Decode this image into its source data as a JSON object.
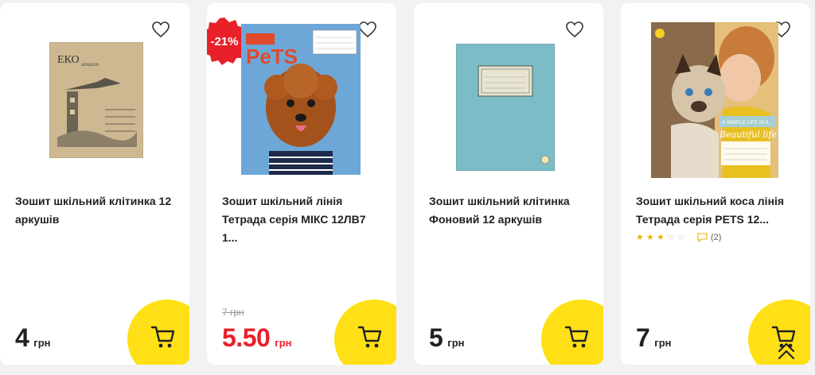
{
  "currency": "грн",
  "accent_color": "#ffe016",
  "sale_color": "#e8202a",
  "products": [
    {
      "title": "Зошит шкільний клітинка 12 аркушів",
      "price": "4",
      "image_label": "ЕКО"
    },
    {
      "title": "Зошит шкільний лінія Тетрада серія МІКС 12ЛВ7 1...",
      "price": "5.50",
      "old_price": "7 грн",
      "badge": "-21%",
      "image_label": "PeTS"
    },
    {
      "title": "Зошит шкільний клітинка Фоновий 12 аркушів",
      "price": "5"
    },
    {
      "title": "Зошит шкільний коса лінія Тетрада серія PETS 12...",
      "price": "7",
      "rating": 3,
      "reviews": "(2)",
      "image_text": "A SIMPLE LIFE IS A",
      "image_script": "Beautiful life"
    }
  ],
  "icons": {
    "favorite": "heart-outline-icon",
    "cart": "shopping-cart-icon",
    "scroll_top": "double-chevron-up-icon",
    "reviews": "comment-icon"
  }
}
